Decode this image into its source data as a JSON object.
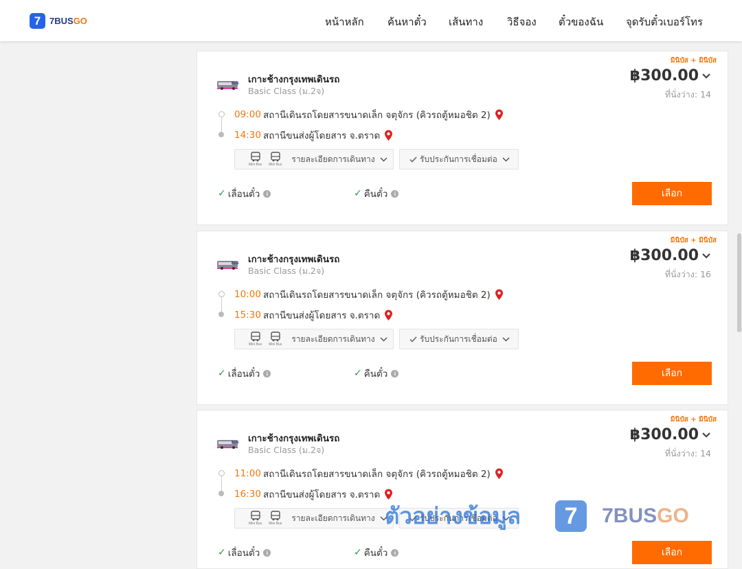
{
  "header": {
    "logo_digit": "7",
    "logo_text_a": "7BUS",
    "logo_text_b": "GO",
    "nav": [
      "หน้าหลัก",
      "ค้นหาตั๋ว",
      "เส้นทาง",
      "วิธีจอง",
      "ตั๋วของฉัน",
      "จุดรับตั๋วเบอร์โทร"
    ]
  },
  "trips": [
    {
      "tag": "มินิบัส + มินิบัส",
      "operator": "เกาะช้างกรุงเทพเดินรถ",
      "class": "Basic Class (ม.2จ)",
      "price": "฿300.00",
      "seats_label": "ที่นั่งว่าง:",
      "seats": "14",
      "depart_time": "09:00",
      "depart_station": "สถานีเดินรถโดยสารขนาดเล็ก จตุจักร (คิวรถตู้หมอชิต 2)",
      "arrive_time": "14:30",
      "arrive_station": "สถานีขนส่งผู้โดยสาร จ.ตราด",
      "bus_caption": "Mini Bus",
      "route_detail": "รายละเอียดการเดินทาง",
      "insurance": "รับประกันการเชื่อมต่อ",
      "policy_change": "เลื่อนตั๋ว",
      "policy_refund": "คืนตั๋ว",
      "select": "เลือก"
    },
    {
      "tag": "มินิบัส + มินิบัส",
      "operator": "เกาะช้างกรุงเทพเดินรถ",
      "class": "Basic Class (ม.2จ)",
      "price": "฿300.00",
      "seats_label": "ที่นั่งว่าง:",
      "seats": "16",
      "depart_time": "10:00",
      "depart_station": "สถานีเดินรถโดยสารขนาดเล็ก จตุจักร (คิวรถตู้หมอชิต 2)",
      "arrive_time": "15:30",
      "arrive_station": "สถานีขนส่งผู้โดยสาร จ.ตราด",
      "bus_caption": "Mini Bus",
      "route_detail": "รายละเอียดการเดินทาง",
      "insurance": "รับประกันการเชื่อมต่อ",
      "policy_change": "เลื่อนตั๋ว",
      "policy_refund": "คืนตั๋ว",
      "select": "เลือก"
    },
    {
      "tag": "มินิบัส + มินิบัส",
      "operator": "เกาะช้างกรุงเทพเดินรถ",
      "class": "Basic Class (ม.2จ)",
      "price": "฿300.00",
      "seats_label": "ที่นั่งว่าง:",
      "seats": "14",
      "depart_time": "11:00",
      "depart_station": "สถานีเดินรถโดยสารขนาดเล็ก จตุจักร (คิวรถตู้หมอชิต 2)",
      "arrive_time": "16:30",
      "arrive_station": "สถานีขนส่งผู้โดยสาร จ.ตราด",
      "bus_caption": "Mini Bus",
      "route_detail": "รายละเอียดการเดินทาง",
      "insurance": "รับประกันการเชื่อมต่อ",
      "policy_change": "เลื่อนตั๋ว",
      "policy_refund": "คืนตั๋ว",
      "select": "เลือก"
    }
  ],
  "watermark": {
    "text": "ตัวอย่างข้อมูล",
    "logo_digit": "7",
    "brand_a": "7BUS",
    "brand_b": "GO"
  }
}
